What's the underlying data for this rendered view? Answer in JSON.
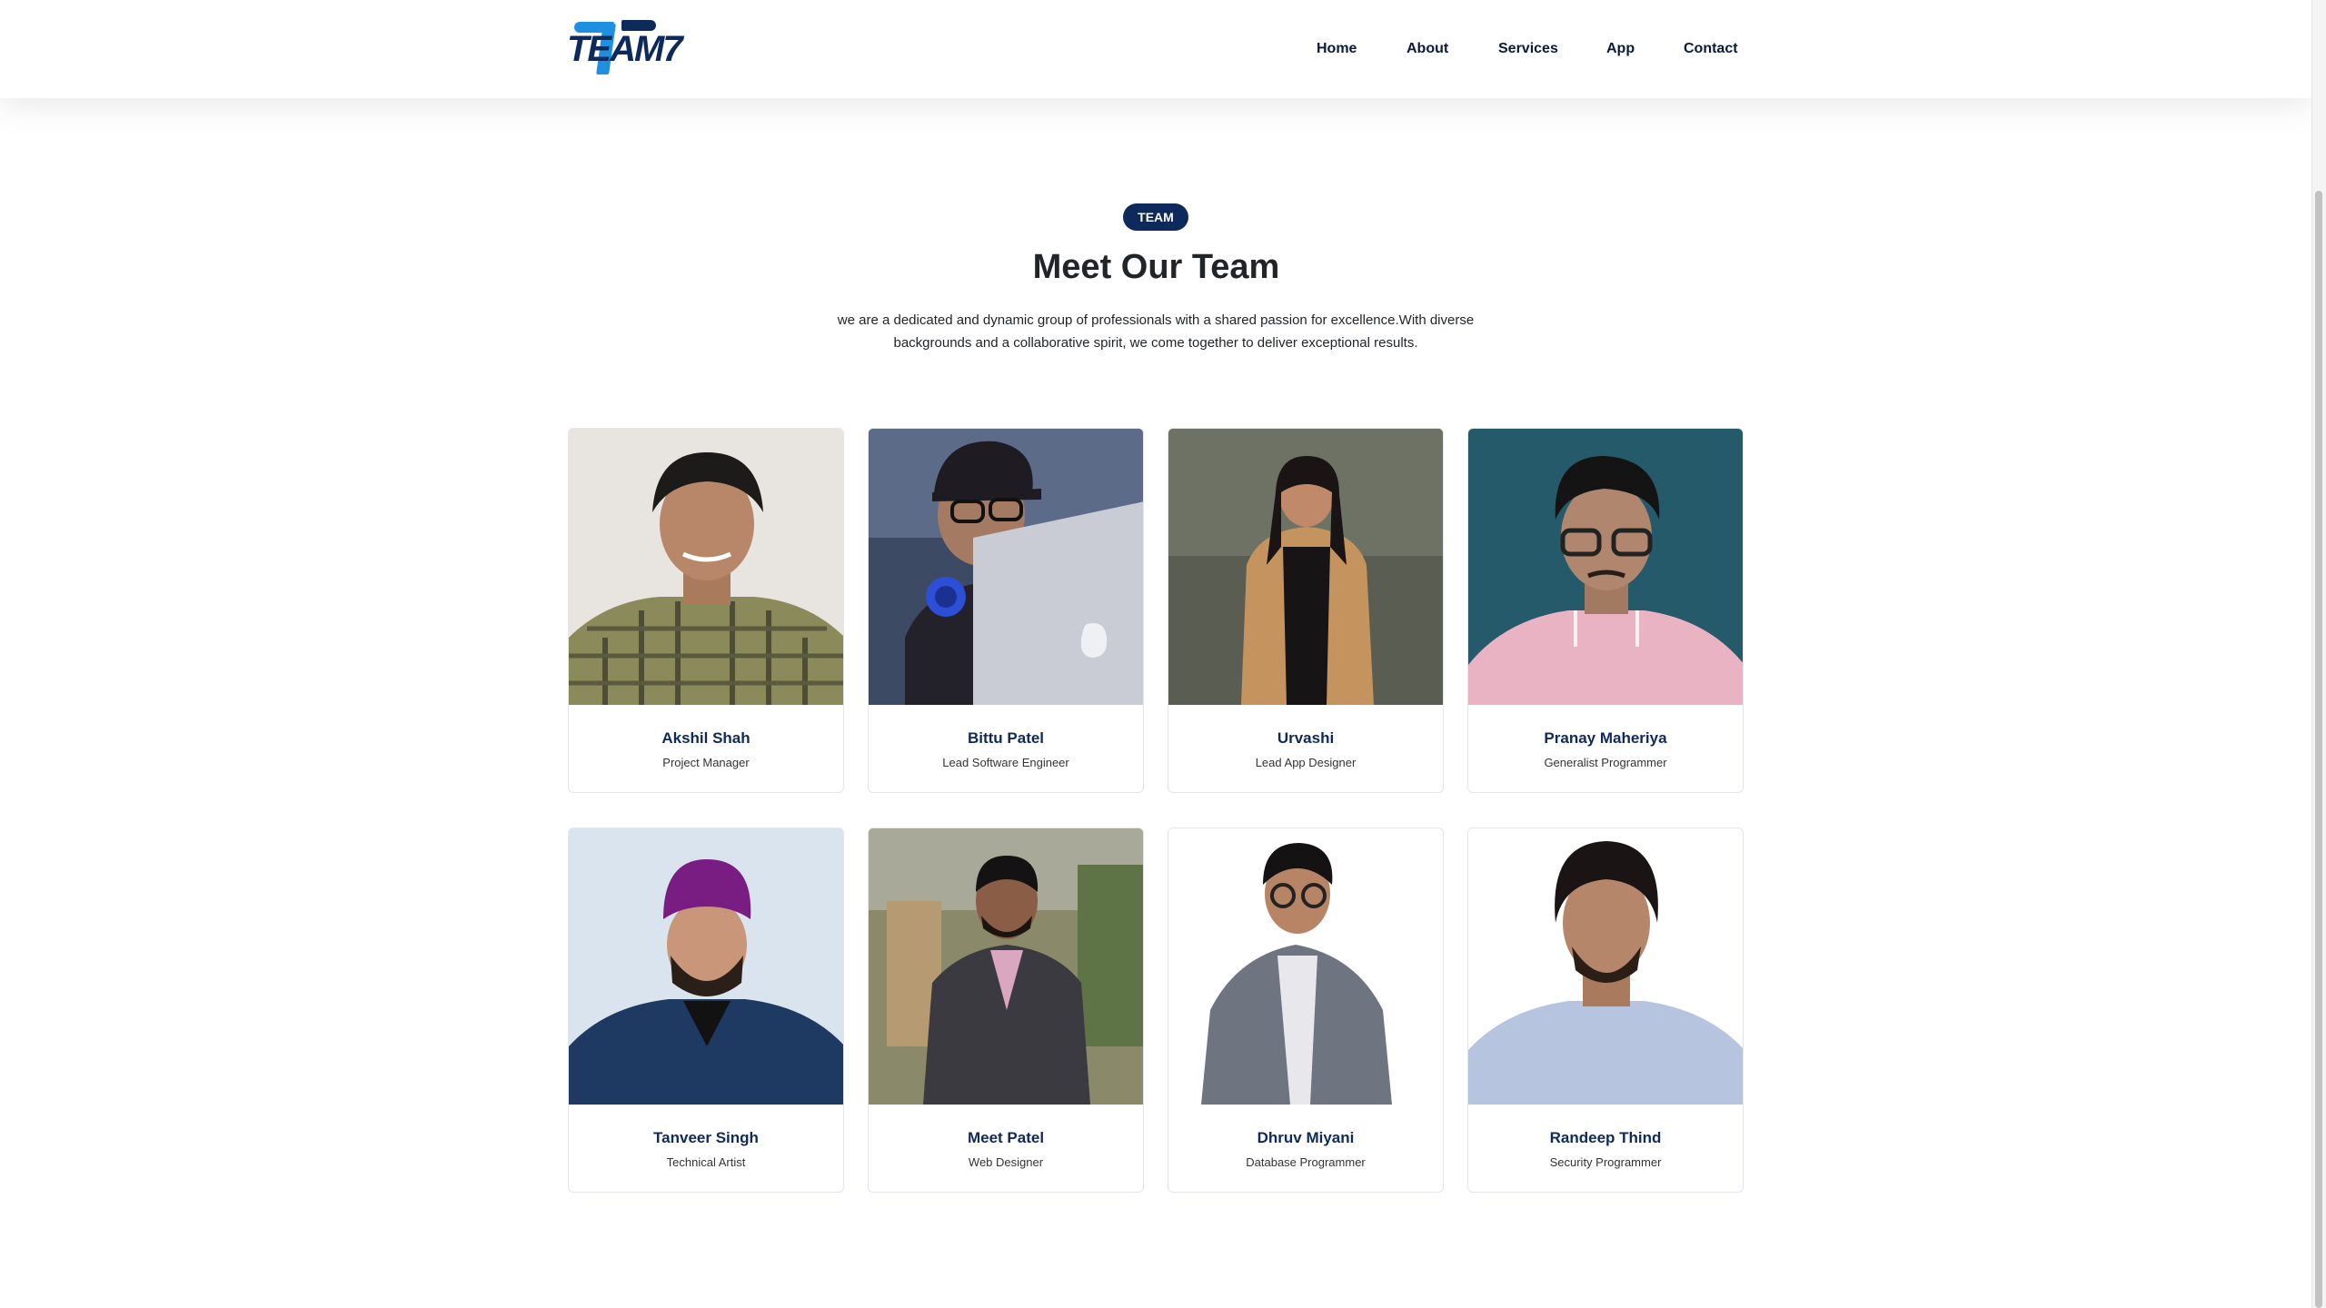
{
  "header": {
    "logo_text": "TEAM7",
    "nav": [
      "Home",
      "About",
      "Services",
      "App",
      "Contact"
    ]
  },
  "section": {
    "badge": "TEAM",
    "title": "Meet Our Team",
    "description": "we are a dedicated and dynamic group of professionals with a shared passion for excellence.With diverse backgrounds and a collaborative spirit, we come together to deliver exceptional results."
  },
  "team": [
    {
      "name": "Akshil Shah",
      "role": "Project Manager"
    },
    {
      "name": "Bittu Patel",
      "role": "Lead Software Engineer"
    },
    {
      "name": "Urvashi",
      "role": "Lead App Designer"
    },
    {
      "name": "Pranay Maheriya",
      "role": "Generalist Programmer"
    },
    {
      "name": "Tanveer Singh",
      "role": "Technical Artist"
    },
    {
      "name": "Meet Patel",
      "role": "Web Designer"
    },
    {
      "name": "Dhruv Miyani",
      "role": "Database Programmer"
    },
    {
      "name": "Randeep Thind",
      "role": "Security Programmer"
    }
  ],
  "colors": {
    "primary": "#0e2a5c",
    "accent": "#1f8fe0",
    "text": "#212529"
  }
}
